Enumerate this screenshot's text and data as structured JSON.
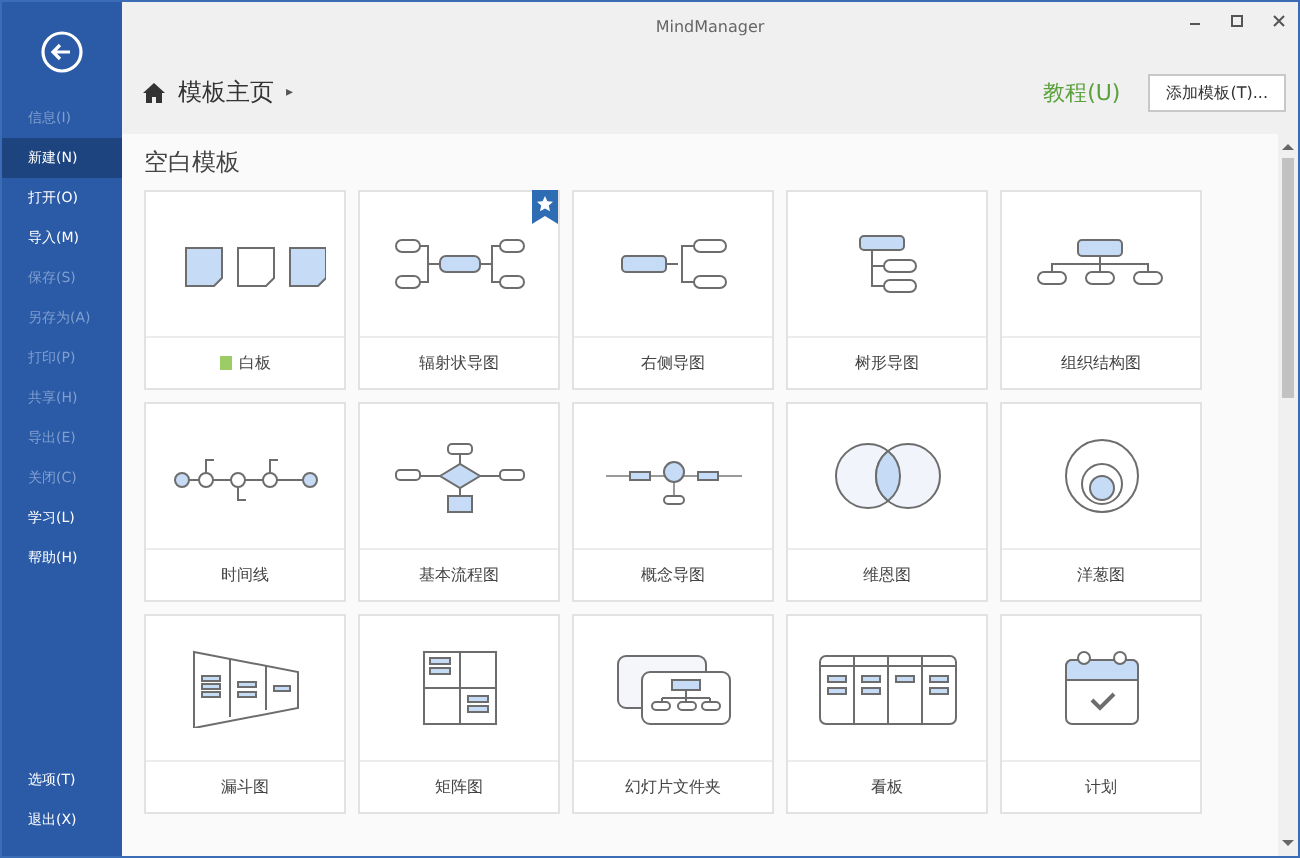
{
  "window": {
    "title": "MindManager"
  },
  "sidebar": {
    "items": [
      {
        "label": "信息(I)",
        "selected": false,
        "disabled": true
      },
      {
        "label": "新建(N)",
        "selected": true,
        "disabled": false
      },
      {
        "label": "打开(O)",
        "selected": false,
        "disabled": false
      },
      {
        "label": "导入(M)",
        "selected": false,
        "disabled": false
      },
      {
        "label": "保存(S)",
        "selected": false,
        "disabled": true
      },
      {
        "label": "另存为(A)",
        "selected": false,
        "disabled": true
      },
      {
        "label": "打印(P)",
        "selected": false,
        "disabled": true
      },
      {
        "label": "共享(H)",
        "selected": false,
        "disabled": true
      },
      {
        "label": "导出(E)",
        "selected": false,
        "disabled": true
      },
      {
        "label": "关闭(C)",
        "selected": false,
        "disabled": true
      },
      {
        "label": "学习(L)",
        "selected": false,
        "disabled": false
      },
      {
        "label": "帮助(H)",
        "selected": false,
        "disabled": false
      }
    ],
    "bottom_items": [
      {
        "label": "选项(T)",
        "selected": false,
        "disabled": false
      },
      {
        "label": "退出(X)",
        "selected": false,
        "disabled": false
      }
    ]
  },
  "breadcrumb": {
    "label": "模板主页",
    "separator": "▸"
  },
  "tutorial_link": "教程(U)",
  "add_template_button": "添加模板(T)...",
  "section_title": "空白模板",
  "templates": [
    {
      "label": "白板",
      "kind": "pages",
      "new": true,
      "starred": false
    },
    {
      "label": "辐射状导图",
      "kind": "radial",
      "new": false,
      "starred": true
    },
    {
      "label": "右侧导图",
      "kind": "right",
      "new": false,
      "starred": false
    },
    {
      "label": "树形导图",
      "kind": "tree",
      "new": false,
      "starred": false
    },
    {
      "label": "组织结构图",
      "kind": "org",
      "new": false,
      "starred": false
    },
    {
      "label": "时间线",
      "kind": "timeline",
      "new": false,
      "starred": false
    },
    {
      "label": "基本流程图",
      "kind": "flow",
      "new": false,
      "starred": false
    },
    {
      "label": "概念导图",
      "kind": "concept",
      "new": false,
      "starred": false
    },
    {
      "label": "维恩图",
      "kind": "venn",
      "new": false,
      "starred": false
    },
    {
      "label": "洋葱图",
      "kind": "onion",
      "new": false,
      "starred": false
    },
    {
      "label": "漏斗图",
      "kind": "funnel",
      "new": false,
      "starred": false
    },
    {
      "label": "矩阵图",
      "kind": "matrix",
      "new": false,
      "starred": false
    },
    {
      "label": "幻灯片文件夹",
      "kind": "slides",
      "new": false,
      "starred": false
    },
    {
      "label": "看板",
      "kind": "kanban",
      "new": false,
      "starred": false
    },
    {
      "label": "计划",
      "kind": "calendar",
      "new": false,
      "starred": false
    }
  ]
}
